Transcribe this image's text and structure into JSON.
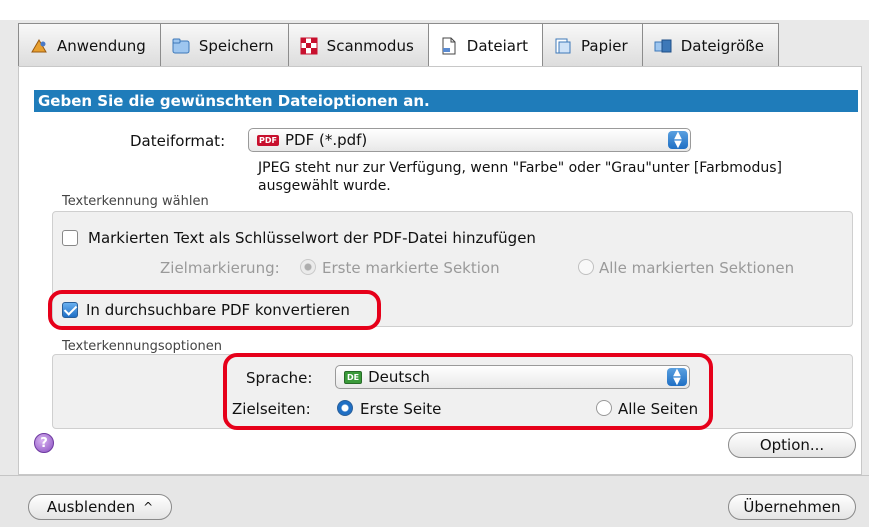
{
  "tabs": [
    {
      "label": "Anwendung",
      "icon": "application-icon"
    },
    {
      "label": "Speichern",
      "icon": "folder-icon"
    },
    {
      "label": "Scanmodus",
      "icon": "scan-mode-icon"
    },
    {
      "label": "Dateiart",
      "icon": "document-icon"
    },
    {
      "label": "Papier",
      "icon": "paper-icon"
    },
    {
      "label": "Dateigröße",
      "icon": "file-size-icon"
    }
  ],
  "selected_tab": "Dateiart",
  "header": "Geben Sie die gewünschten Dateioptionen an.",
  "file_format": {
    "label": "Dateiformat:",
    "badge": "PDF",
    "value": "PDF (*.pdf)",
    "note_line1": "JPEG steht nur zur Verfügung, wenn \"Farbe\" oder \"Grau\"unter [Farbmodus]",
    "note_line2": "ausgewählt wurde."
  },
  "ocr_group": {
    "title": "Texterkennung wählen",
    "keyword_checkbox": "Markierten Text als Schlüsselwort der PDF-Datei hinzufügen",
    "target_label": "Zielmarkierung:",
    "target_first": "Erste markierte Sektion",
    "target_all": "Alle markierten Sektionen",
    "searchable_checkbox": "In durchsuchbare PDF konvertieren"
  },
  "ocr_options": {
    "title": "Texterkennungsoptionen",
    "language_label": "Sprache:",
    "language_badge": "DE",
    "language_value": "Deutsch",
    "pages_label": "Zielseiten:",
    "pages_first": "Erste Seite",
    "pages_all": "Alle Seiten"
  },
  "buttons": {
    "help": "?",
    "option": "Option...",
    "hide": "Ausblenden",
    "hide_arrow": "^",
    "apply": "Übernehmen"
  },
  "colors": {
    "header": "#1f7cba",
    "highlight": "#e6001a"
  }
}
